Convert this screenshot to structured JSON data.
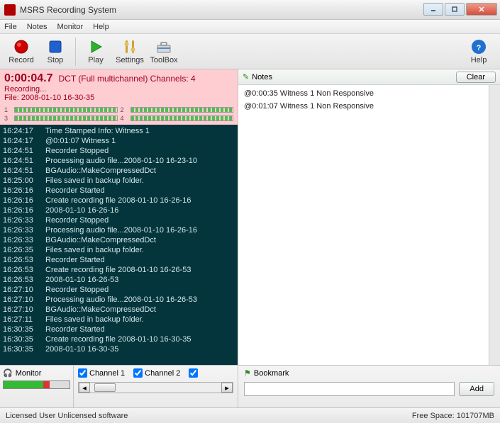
{
  "window": {
    "title": "MSRS Recording System"
  },
  "menu": {
    "file": "File",
    "notes": "Notes",
    "monitor": "Monitor",
    "help": "Help"
  },
  "toolbar": {
    "record": "Record",
    "stop": "Stop",
    "play": "Play",
    "settings": "Settings",
    "toolbox": "ToolBox",
    "help": "Help"
  },
  "status": {
    "timecode": "0:00:04.7",
    "desc": "DCT (Full multichannel) Channels: 4",
    "state": "Recording...",
    "file_label": "File: 2008-01-10 16-30-35",
    "ch1": "1",
    "ch2": "2",
    "ch3": "3",
    "ch4": "4"
  },
  "log": [
    {
      "t": "16:24:17",
      "m": "Time Stamped Info: Witness 1"
    },
    {
      "t": "16:24:17",
      "m": "@0:01:07 Witness 1"
    },
    {
      "t": "16:24:51",
      "m": "Recorder Stopped"
    },
    {
      "t": "16:24:51",
      "m": "Processing audio file...2008-01-10 16-23-10"
    },
    {
      "t": "16:24:51",
      "m": "BGAudio::MakeCompressedDct"
    },
    {
      "t": "16:25:00",
      "m": "Files saved in backup folder."
    },
    {
      "t": "16:26:16",
      "m": "Recorder Started"
    },
    {
      "t": "16:26:16",
      "m": "Create recording file 2008-01-10 16-26-16"
    },
    {
      "t": "16:26:16",
      "m": "2008-01-10 16-26-16"
    },
    {
      "t": "16:26:33",
      "m": "Recorder Stopped"
    },
    {
      "t": "16:26:33",
      "m": "Processing audio file...2008-01-10 16-26-16"
    },
    {
      "t": "16:26:33",
      "m": "BGAudio::MakeCompressedDct"
    },
    {
      "t": "16:26:35",
      "m": "Files saved in backup folder."
    },
    {
      "t": "16:26:53",
      "m": "Recorder Started"
    },
    {
      "t": "16:26:53",
      "m": "Create recording file 2008-01-10 16-26-53"
    },
    {
      "t": "16:26:53",
      "m": "2008-01-10 16-26-53"
    },
    {
      "t": "16:27:10",
      "m": "Recorder Stopped"
    },
    {
      "t": "16:27:10",
      "m": "Processing audio file...2008-01-10 16-26-53"
    },
    {
      "t": "16:27:10",
      "m": "BGAudio::MakeCompressedDct"
    },
    {
      "t": "16:27:11",
      "m": "Files saved in backup folder."
    },
    {
      "t": "16:30:35",
      "m": "Recorder Started"
    },
    {
      "t": "16:30:35",
      "m": "Create recording file 2008-01-10 16-30-35"
    },
    {
      "t": "16:30:35",
      "m": "2008-01-10 16-30-35"
    }
  ],
  "notes": {
    "header": "Notes",
    "clear": "Clear",
    "items": [
      "@0:00:35 Witness 1 Non Responsive",
      "@0:01:07 Witness 1 Non Responsive"
    ]
  },
  "monitor": {
    "label": "Monitor"
  },
  "channels": {
    "c1": "Channel 1",
    "c2": "Channel 2"
  },
  "bookmark": {
    "label": "Bookmark",
    "add": "Add",
    "placeholder": ""
  },
  "statusbar": {
    "license": "Licensed User Unlicensed software",
    "freespace": "Free Space: 101707MB"
  }
}
